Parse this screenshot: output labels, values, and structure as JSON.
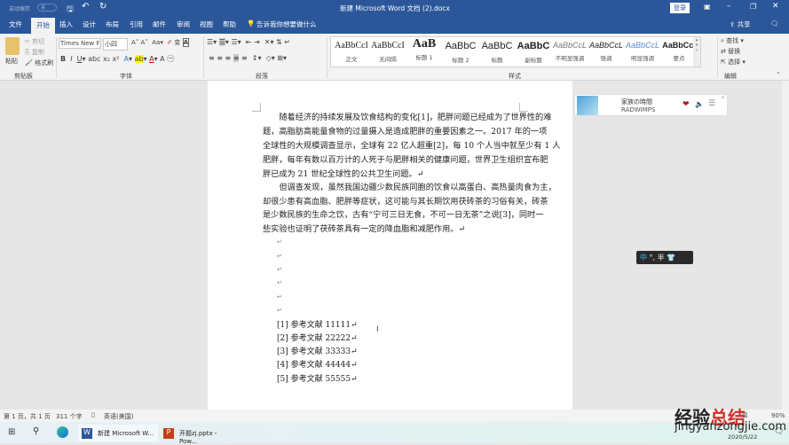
{
  "titlebar": {
    "autosave": "自动保存",
    "autosave_state": "关",
    "title": "新建 Microsoft Word 文档 (2).docx",
    "login": "登录"
  },
  "tabs": [
    "文件",
    "开始",
    "插入",
    "设计",
    "布局",
    "引用",
    "邮件",
    "审阅",
    "视图",
    "帮助"
  ],
  "tell_me": "告诉我你想要做什么",
  "share": "共享",
  "ribbon": {
    "clipboard": {
      "paste": "粘贴",
      "cut": "剪切",
      "copy": "复制",
      "format_painter": "格式刷",
      "label": "剪贴板"
    },
    "font": {
      "name": "Times New F",
      "size": "小四",
      "label": "字体"
    },
    "paragraph": {
      "label": "段落"
    },
    "styles": {
      "label": "样式",
      "items": [
        {
          "preview": "AaBbCcI",
          "name": "正文"
        },
        {
          "preview": "AaBbCcI",
          "name": "无间隔"
        },
        {
          "preview": "AaB",
          "name": "标题 1"
        },
        {
          "preview": "AaBbC",
          "name": "标题 2"
        },
        {
          "preview": "AaBbC",
          "name": "标题"
        },
        {
          "preview": "AaBbC",
          "name": "副标题"
        },
        {
          "preview": "AaBbCcL",
          "name": "不明显强调"
        },
        {
          "preview": "AaBbCcL",
          "name": "强调"
        },
        {
          "preview": "AaBbCcL",
          "name": "明显强调"
        },
        {
          "preview": "AaBbCcI",
          "name": "要点"
        }
      ]
    },
    "editing": {
      "find": "查找",
      "replace": "替换",
      "select": "选择",
      "label": "编辑"
    }
  },
  "document": {
    "lines": [
      "　　随着经济的持续发展及饮食结构的变化[1]，肥胖问题已经成为了世界性的难",
      "题，高脂肪高能量食物的过量摄入是造成肥胖的重要因素之一。2017 年的一项",
      "全球性的大规模调查显示，全球有 22 亿人超重[2]，每 10 个人当中就至少有 1 人",
      "肥胖，每年有数以百万计的人死于与肥胖相关的健康问题，世界卫生组织宣布肥",
      "胖已成为 21 世纪全球性的公共卫生问题。↵",
      "　　但调查发现，虽然我国边疆少数民族同胞的饮食以高蛋白、高热量肉食为主，",
      "却很少患有高血脂、肥胖等症状，这可能与其长期饮用茯砖茶的习俗有关，砖茶",
      "是少数民族的生命之饮，古有“宁可三日无食，不可一日无茶”之说[3]，同时一",
      "些实验也证明了茯砖茶具有一定的降血脂和减肥作用。↵"
    ],
    "para_mark": "↵",
    "references": [
      "[1]  参考文献 11111↵",
      "[2]  参考文献 22222↵",
      "[3]  参考文献 33333↵",
      "[4]  参考文献 44444↵",
      "[5]  参考文献 55555↵"
    ]
  },
  "music": {
    "song": "家族の時間",
    "artist": "RADWIMPS"
  },
  "ime": {
    "mode": "中",
    "punct": "°,",
    "width": "半"
  },
  "status": {
    "page": "第 1 页，共 1 页",
    "words": "311 个字",
    "lang": "英语(美国)",
    "zoom": "90%"
  },
  "taskbar": {
    "word": "新建 Microsoft W...",
    "ppt": "开题zj.pptx - Pow...",
    "date": "2020/5/22"
  },
  "watermark": {
    "cn": "经验总结",
    "url": "jingyanzongjie.com"
  }
}
